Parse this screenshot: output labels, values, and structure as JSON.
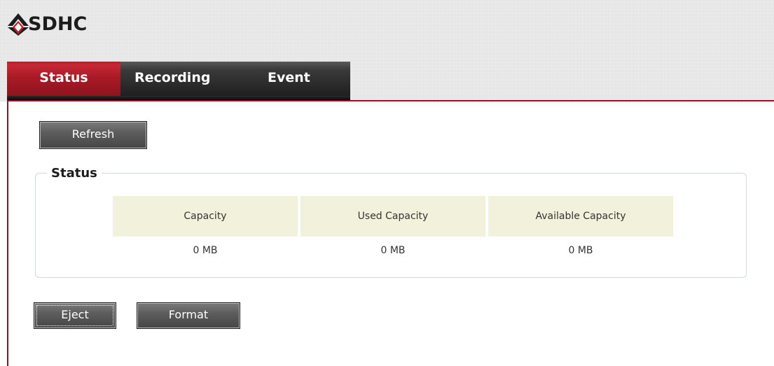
{
  "app": {
    "title": "SDHC"
  },
  "tabs": [
    {
      "label": "Status",
      "active": true
    },
    {
      "label": "Recording",
      "active": false
    },
    {
      "label": "Event",
      "active": false
    }
  ],
  "toolbar": {
    "refresh_label": "Refresh"
  },
  "status_section": {
    "legend": "Status",
    "columns": [
      "Capacity",
      "Used Capacity",
      "Available Capacity"
    ],
    "values": [
      "0 MB",
      "0 MB",
      "0 MB"
    ]
  },
  "actions": {
    "eject_label": "Eject",
    "format_label": "Format"
  },
  "colors": {
    "accent": "#8e1520",
    "tab_inactive": "#2a2a2a",
    "table_header_bg": "#f2f2dc"
  }
}
